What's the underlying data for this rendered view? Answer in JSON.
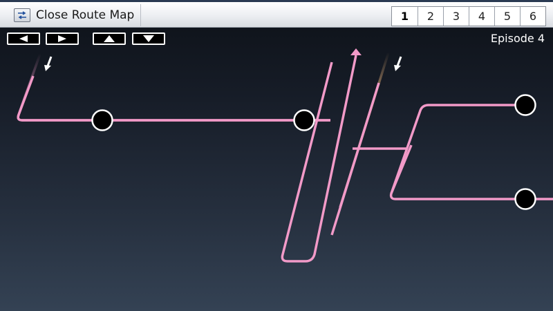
{
  "toolbar": {
    "close_label": "Close Route Map",
    "close_icon": "swap-arrows-icon"
  },
  "episode_tabs": [
    "1",
    "2",
    "3",
    "4",
    "5",
    "6"
  ],
  "active_tab": "1",
  "nav": {
    "left_icon": "triangle-left-icon",
    "right_icon": "triangle-right-icon",
    "up_icon": "triangle-up-icon",
    "down_icon": "triangle-down-icon"
  },
  "episode_label": "Episode 4",
  "colors": {
    "route": "#f29ac8",
    "route_hot": "#f0304a",
    "node": "#000000",
    "node_border": "#ffffff"
  }
}
